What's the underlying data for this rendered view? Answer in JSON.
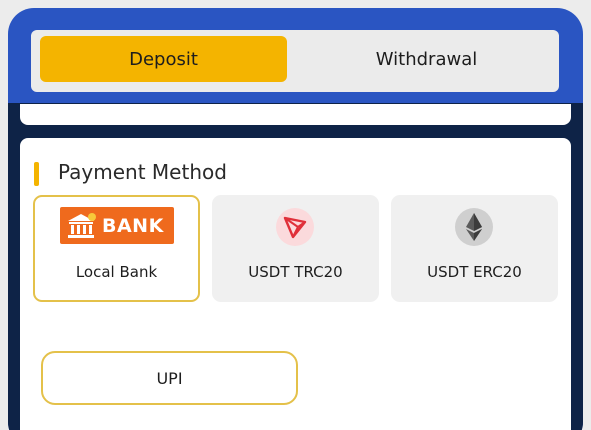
{
  "tabs": {
    "deposit_label": "Deposit",
    "withdrawal_label": "Withdrawal",
    "active": "Deposit"
  },
  "payment": {
    "section_title": "Payment Method",
    "methods": [
      {
        "label": "Local Bank",
        "logo_text": "BANK",
        "icon": "bank-icon",
        "selected": true
      },
      {
        "label": "USDT TRC20",
        "icon": "tron-icon",
        "selected": false
      },
      {
        "label": "USDT ERC20",
        "icon": "ethereum-icon",
        "selected": false
      }
    ],
    "upi_label": "UPI"
  },
  "colors": {
    "frame_blue": "#2a55c2",
    "accent_yellow": "#f4b400",
    "bank_orange": "#ef6a1d",
    "tron_red": "#e0303a",
    "navy": "#0e2347"
  }
}
